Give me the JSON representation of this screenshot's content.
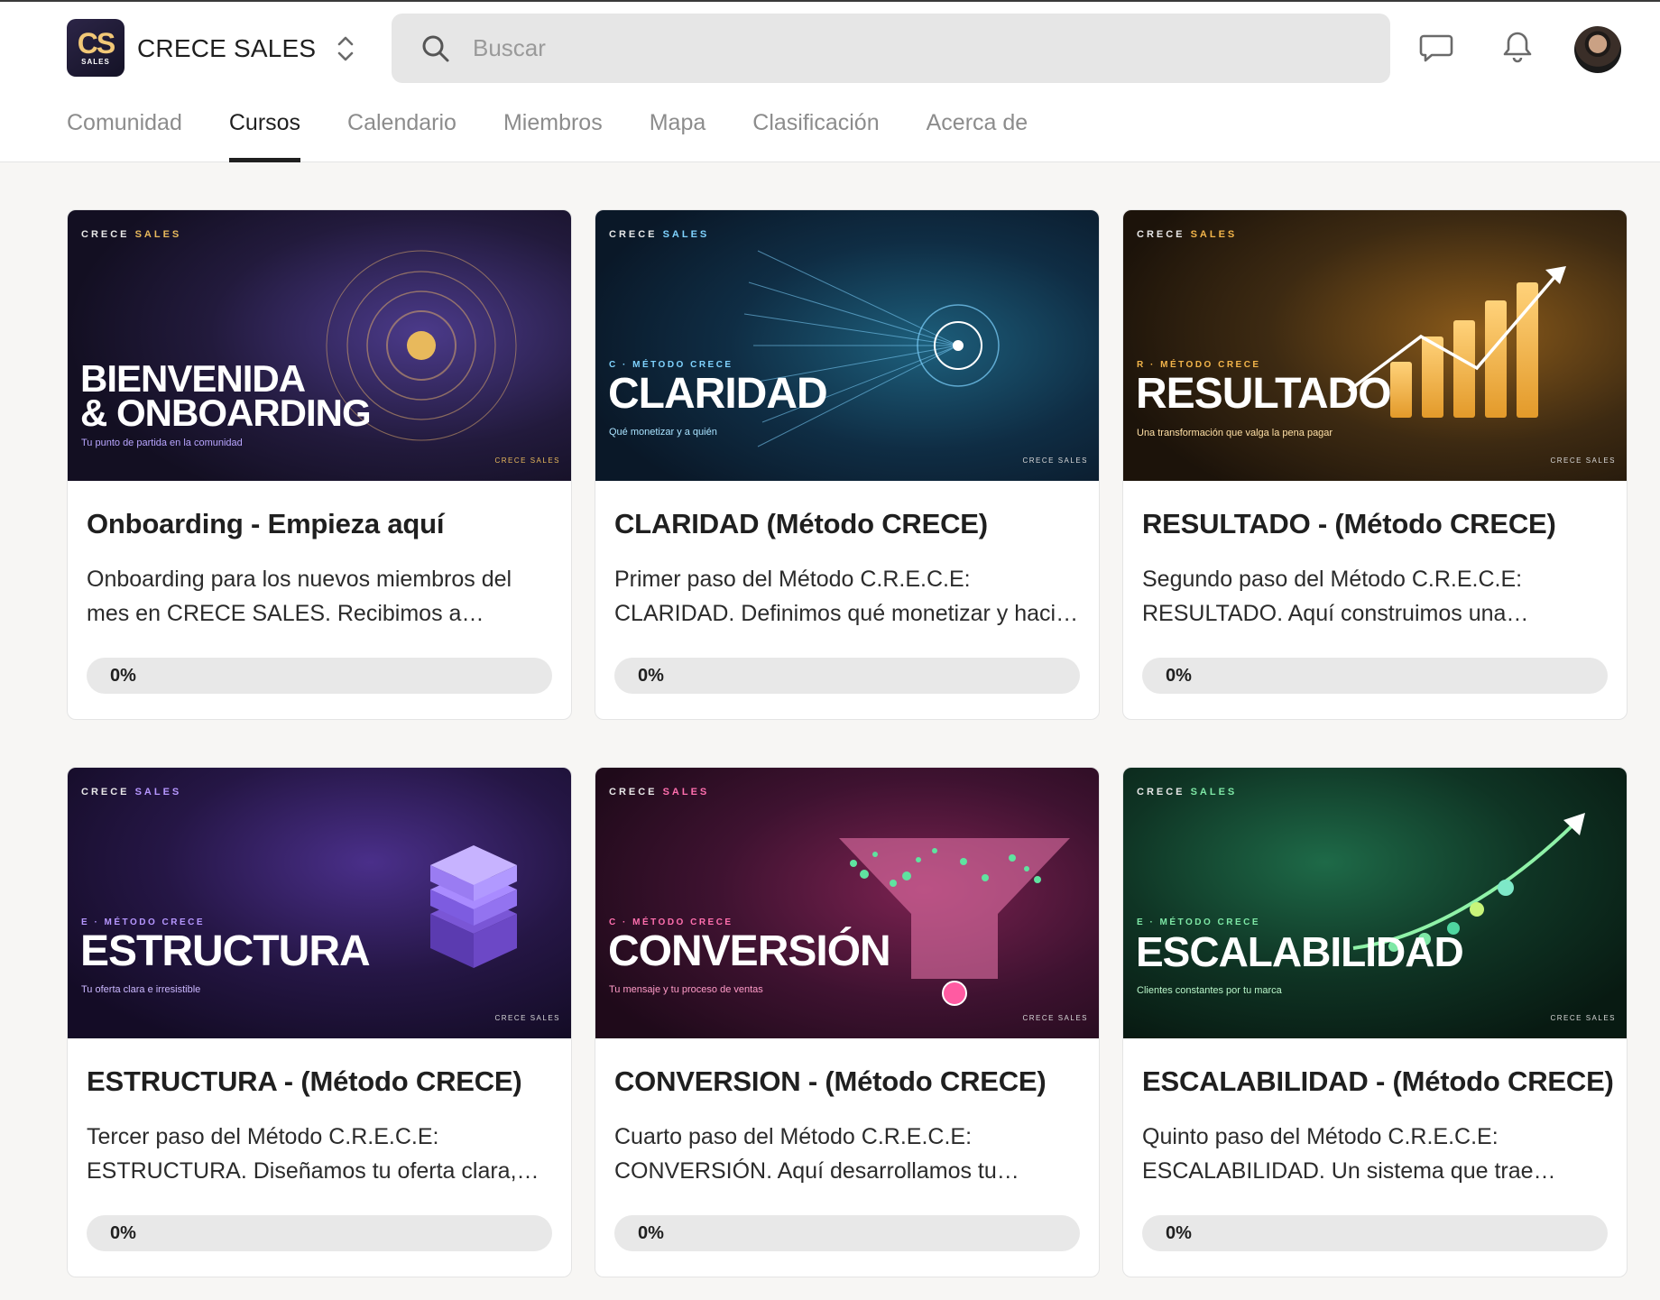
{
  "app": {
    "logo_text": "CS",
    "logo_sub": "SALES",
    "name": "CRECE SALES"
  },
  "search": {
    "placeholder": "Buscar"
  },
  "tabs": [
    {
      "label": "Comunidad",
      "active": false
    },
    {
      "label": "Cursos",
      "active": true
    },
    {
      "label": "Calendario",
      "active": false
    },
    {
      "label": "Miembros",
      "active": false
    },
    {
      "label": "Mapa",
      "active": false
    },
    {
      "label": "Clasificación",
      "active": false
    },
    {
      "label": "Acerca de",
      "active": false
    }
  ],
  "courses": [
    {
      "thumb": {
        "brand_a": "CRECE",
        "brand_b": "SALES",
        "brand_color": "#e8b95c",
        "step": "",
        "big": "BIENVENIDA\n& ONBOARDING",
        "tagline": "Tu punto de partida en la comunidad",
        "tag_color": "#b9a6ff",
        "foot": "CRECE SALES",
        "foot_color": "#e8b95c"
      },
      "title": "Onboarding - Empieza aquí",
      "description": "Onboarding para los nuevos miembros del mes en CRECE SALES. Recibimos a quienes…",
      "progress": "0%"
    },
    {
      "thumb": {
        "brand_a": "CRECE",
        "brand_b": "SALES",
        "brand_color": "#7fd3ff",
        "step": "C · MÉTODO CRECE",
        "big": "CLARIDAD",
        "tagline": "Qué monetizar y a quién",
        "tag_color": "#a9e3ff",
        "foot": "CRECE SALES",
        "foot_color": "#c9e4ef"
      },
      "title": "CLARIDAD (Método CRECE)",
      "description": "Primer paso del Método C.R.E.C.E: CLARIDAD. Definimos qué monetizar y haci…",
      "progress": "0%"
    },
    {
      "thumb": {
        "brand_a": "CRECE",
        "brand_b": "SALES",
        "brand_color": "#f3b54a",
        "step": "R · MÉTODO CRECE",
        "big": "RESULTADO",
        "tagline": "Una transformación que valga la pena pagar",
        "tag_color": "#ffe0a6",
        "foot": "CRECE SALES",
        "foot_color": "#f0d8a8"
      },
      "title": "RESULTADO - (Método CRECE)",
      "description": "Segundo paso del Método C.R.E.C.E: RESULTADO. Aquí construimos una…",
      "progress": "0%"
    },
    {
      "thumb": {
        "brand_a": "CRECE",
        "brand_b": "SALES",
        "brand_color": "#b697ff",
        "step": "E · MÉTODO CRECE",
        "big": "ESTRUCTURA",
        "tagline": "Tu oferta clara e irresistible",
        "tag_color": "#cbb8ff",
        "foot": "CRECE SALES",
        "foot_color": "#d8cdf4"
      },
      "title": "ESTRUCTURA - (Método CRECE)",
      "description": "Tercer paso del Método C.R.E.C.E: ESTRUCTURA. Diseñamos tu oferta clara,…",
      "progress": "0%"
    },
    {
      "thumb": {
        "brand_a": "CRECE",
        "brand_b": "SALES",
        "brand_color": "#ff6fae",
        "step": "C · MÉTODO CRECE",
        "big": "CONVERSIÓN",
        "tagline": "Tu mensaje y tu proceso de ventas",
        "tag_color": "#ff9cc8",
        "foot": "CRECE SALES",
        "foot_color": "#f1c9da"
      },
      "title": "CONVERSION - (Método CRECE)",
      "description": "Cuarto paso del Método C.R.E.C.E: CONVERSIÓN. Aquí desarrollamos tu…",
      "progress": "0%"
    },
    {
      "thumb": {
        "brand_a": "CRECE",
        "brand_b": "SALES",
        "brand_color": "#7ee8a6",
        "step": "E · MÉTODO CRECE",
        "big": "ESCALABILIDAD",
        "tagline": "Clientes constantes por tu marca",
        "tag_color": "#b9f5c9",
        "foot": "CRECE SALES",
        "foot_color": "#cfeed8"
      },
      "title": "ESCALABILIDAD - (Método CRECE)",
      "description": "Quinto paso del Método C.R.E.C.E: ESCALABILIDAD. Un sistema que trae…",
      "progress": "0%"
    }
  ]
}
